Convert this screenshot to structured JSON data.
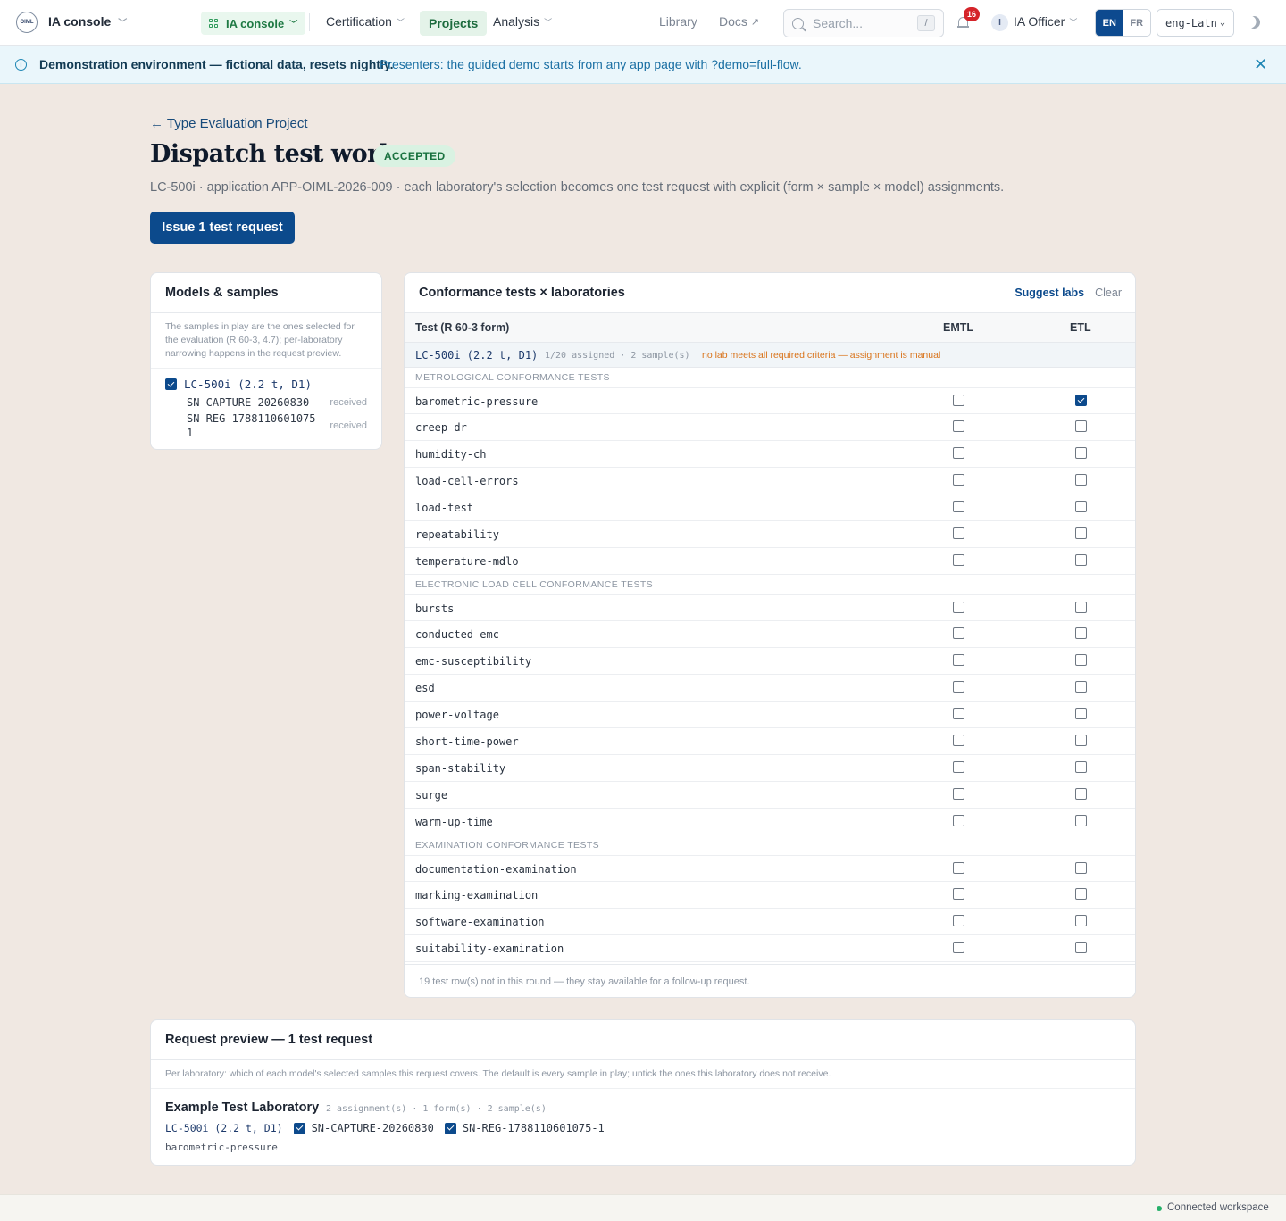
{
  "nav": {
    "brand": "IA console",
    "workspace_chip": "IA console",
    "certification": "Certification",
    "projects": "Projects",
    "analysis": "Analysis",
    "library": "Library",
    "docs": "Docs",
    "search_placeholder": "Search...",
    "search_shortcut": "/",
    "notification_count": "16",
    "avatar_initial": "I",
    "user": "IA Officer",
    "lang_en": "EN",
    "lang_fr": "FR",
    "script_value": "eng-Latn"
  },
  "banner": {
    "title": "Demonstration environment — fictional data, resets nightly.",
    "message": "Presenters: the guided demo starts from any app page with ?demo=full-flow."
  },
  "header": {
    "back": "← Type Evaluation Project",
    "title": "Dispatch test work",
    "status": "ACCEPTED",
    "subtitle": "LC-500i · application APP-OIML-2026-009 · each laboratory's selection becomes one test request with explicit (form × sample × model) assignments.",
    "issue_button": "Issue 1 test request"
  },
  "models_card": {
    "title": "Models & samples",
    "note": "The samples in play are the ones selected for the evaluation (R 60-3, 4.7); per-laboratory narrowing happens in the request preview.",
    "model": "LC-500i (2.2 t, D1)",
    "samples": [
      {
        "sn_line1": "SN-CAPTURE-20260830",
        "sn_line2": "",
        "status": "received"
      },
      {
        "sn_line1": "SN-REG-1788110601075-",
        "sn_line2": "1",
        "status": "received"
      }
    ]
  },
  "matrix": {
    "title": "Conformance tests × laboratories",
    "suggest": "Suggest labs",
    "clear": "Clear",
    "col_test": "Test (R 60-3 form)",
    "col_lab1": "EMTL",
    "col_lab2": "ETL",
    "model": "LC-500i (2.2 t, D1)",
    "model_meta": "1/20 assigned · 2 sample(s)",
    "model_warning": "no lab meets all required criteria — assignment is manual",
    "groups": [
      {
        "name": "METROLOGICAL CONFORMANCE TESTS",
        "tests": [
          {
            "name": "barometric-pressure",
            "emtl": false,
            "etl": true
          },
          {
            "name": "creep-dr",
            "emtl": false,
            "etl": false
          },
          {
            "name": "humidity-ch",
            "emtl": false,
            "etl": false
          },
          {
            "name": "load-cell-errors",
            "emtl": false,
            "etl": false
          },
          {
            "name": "load-test",
            "emtl": false,
            "etl": false
          },
          {
            "name": "repeatability",
            "emtl": false,
            "etl": false
          },
          {
            "name": "temperature-mdlo",
            "emtl": false,
            "etl": false
          }
        ]
      },
      {
        "name": "ELECTRONIC LOAD CELL CONFORMANCE TESTS",
        "tests": [
          {
            "name": "bursts",
            "emtl": false,
            "etl": false
          },
          {
            "name": "conducted-emc",
            "emtl": false,
            "etl": false
          },
          {
            "name": "emc-susceptibility",
            "emtl": false,
            "etl": false
          },
          {
            "name": "esd",
            "emtl": false,
            "etl": false
          },
          {
            "name": "power-voltage",
            "emtl": false,
            "etl": false
          },
          {
            "name": "short-time-power",
            "emtl": false,
            "etl": false
          },
          {
            "name": "span-stability",
            "emtl": false,
            "etl": false
          },
          {
            "name": "surge",
            "emtl": false,
            "etl": false
          },
          {
            "name": "warm-up-time",
            "emtl": false,
            "etl": false
          }
        ]
      },
      {
        "name": "EXAMINATION CONFORMANCE TESTS",
        "tests": [
          {
            "name": "documentation-examination",
            "emtl": false,
            "etl": false
          },
          {
            "name": "marking-examination",
            "emtl": false,
            "etl": false
          },
          {
            "name": "software-examination",
            "emtl": false,
            "etl": false
          },
          {
            "name": "suitability-examination",
            "emtl": false,
            "etl": false
          }
        ]
      }
    ],
    "footer": "19 test row(s) not in this round — they stay available for a follow-up request."
  },
  "preview": {
    "title": "Request preview — 1 test request",
    "note": "Per laboratory: which of each model's selected samples this request covers. The default is every sample in play; untick the ones this laboratory does not receive.",
    "lab": "Example Test Laboratory",
    "lab_meta": "2 assignment(s) · 1 form(s) · 2 sample(s)",
    "model": "LC-500i (2.2 t, D1)",
    "sample1": "SN-CAPTURE-20260830",
    "sample2": "SN-REG-1788110601075-1",
    "test": "barometric-pressure"
  },
  "statusbar": {
    "text": "Connected workspace"
  }
}
